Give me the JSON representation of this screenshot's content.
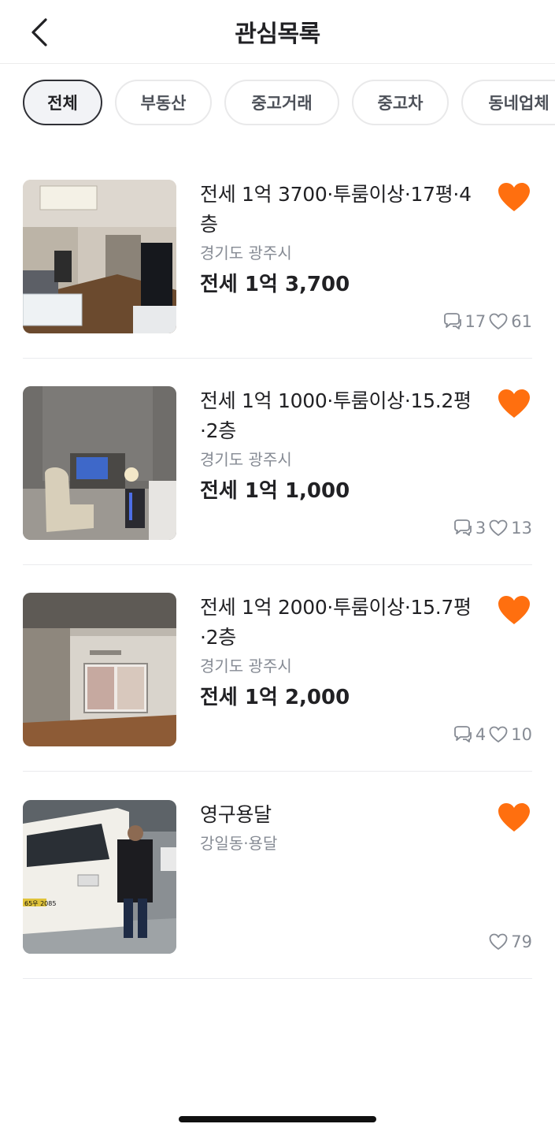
{
  "header": {
    "title": "관심목록",
    "back_icon": "chevron-left-icon"
  },
  "chips": [
    "전체",
    "부동산",
    "중고거래",
    "중고차",
    "동네업체"
  ],
  "accent_color": "#ff6f0f",
  "items": [
    {
      "title": "전세 1억 3700·투룸이상·17평·4층",
      "location": "경기도 광주시",
      "price": "전세  1억 3,700",
      "chats": "17",
      "likes": "61",
      "liked": true
    },
    {
      "title": "전세 1억 1000·투룸이상·15.2평·2층",
      "location": "경기도 광주시",
      "price": "전세  1억 1,000",
      "chats": "3",
      "likes": "13",
      "liked": true
    },
    {
      "title": "전세 1억 2000·투룸이상·15.7평·2층",
      "location": "경기도 광주시",
      "price": "전세  1억 2,000",
      "chats": "4",
      "likes": "10",
      "liked": true
    },
    {
      "title": "영구용달",
      "location": "강일동·용달",
      "price": "",
      "chats": "",
      "likes": "79",
      "liked": true
    }
  ],
  "vehicle_plate": "65우 2085"
}
